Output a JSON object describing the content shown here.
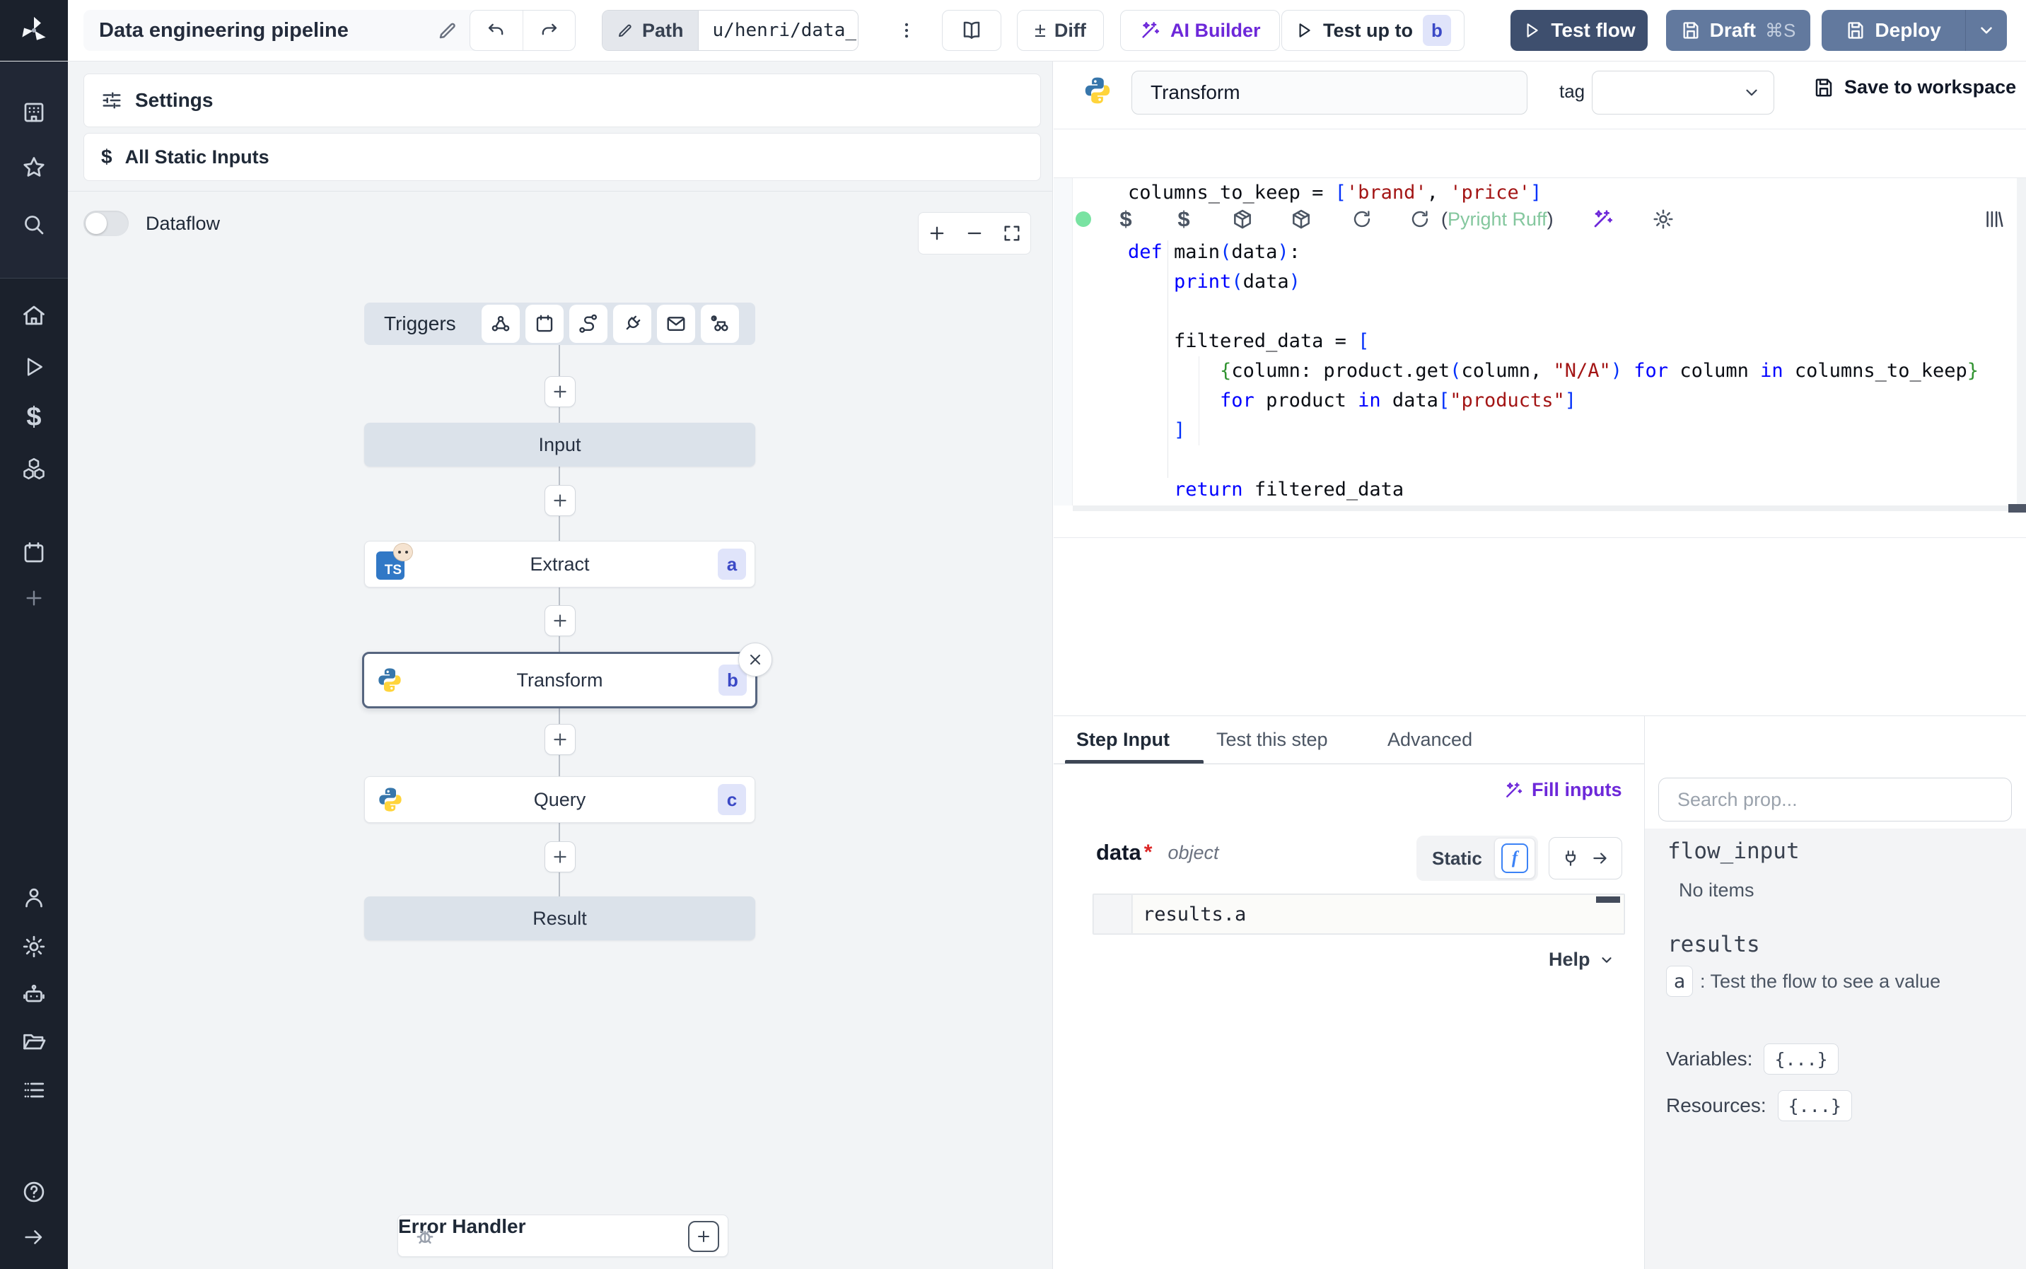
{
  "colors": {
    "sidebar_bg": "#1b212c",
    "accent_indigo": "#3b49c6",
    "badge_bg": "#e0e4fa",
    "purple": "#6d28d9",
    "test_flow_bg": "#3e4f6e",
    "deploy_bg": "#62799e",
    "node_gray_bg": "#dbe2ea",
    "selected_border": "#56657f",
    "lint_green": "#84c79e",
    "status_green": "#79e3a2",
    "code_keyword": "#0000ff",
    "code_string": "#a31515"
  },
  "topbar": {
    "title": "Data engineering pipeline",
    "path_label": "Path",
    "path_value": "u/henri/data_",
    "diff_symbol": "±",
    "diff_label": "Diff",
    "ai_builder_label": "AI Builder",
    "test_up_to_label": "Test up to",
    "test_up_to_badge": "b",
    "test_flow_label": "Test flow",
    "draft_label": "Draft",
    "draft_shortcut": "⌘S",
    "deploy_label": "Deploy"
  },
  "sidebar": {
    "icons": [
      "workspace",
      "favorites",
      "search",
      "home",
      "runs",
      "variables",
      "resources",
      "schedules",
      "add",
      "user",
      "settings",
      "workers",
      "folders",
      "logs",
      "help",
      "expand"
    ]
  },
  "flow": {
    "settings_label": "Settings",
    "static_inputs_symbol": "$",
    "static_inputs_label": "All Static Inputs",
    "dataflow_label": "Dataflow",
    "triggers_label": "Triggers",
    "trigger_icons": [
      "webhook",
      "schedule",
      "http-route",
      "websocket",
      "email",
      "scheduled-poll"
    ],
    "nodes": {
      "input_label": "Input",
      "extract_label": "Extract",
      "extract_badge": "a",
      "extract_lang": "TS",
      "transform_label": "Transform",
      "transform_badge": "b",
      "query_label": "Query",
      "query_badge": "c",
      "result_label": "Result"
    },
    "error_handler_label": "Error Handler"
  },
  "editor": {
    "step_name": "Transform",
    "tag_label": "tag",
    "save_label": "Save to workspace",
    "lint_prefix": "(",
    "lint_text": "Pyright Ruff",
    "lint_suffix": ")"
  },
  "code": {
    "lines": [
      [
        {
          "t": "columns_to_keep = ",
          "c": "pl"
        },
        {
          "t": "[",
          "c": "bk"
        },
        {
          "t": "'brand'",
          "c": "st"
        },
        {
          "t": ", ",
          "c": "pl"
        },
        {
          "t": "'price'",
          "c": "st"
        },
        {
          "t": "]",
          "c": "bk"
        }
      ],
      [],
      [
        {
          "t": "def",
          "c": "kw"
        },
        {
          "t": " main",
          "c": "pl"
        },
        {
          "t": "(",
          "c": "bk"
        },
        {
          "t": "data",
          "c": "pl"
        },
        {
          "t": ")",
          "c": "bk"
        },
        {
          "t": ":",
          "c": "pl"
        }
      ],
      [
        {
          "t": "    ",
          "c": "pl"
        },
        {
          "t": "print",
          "c": "kw"
        },
        {
          "t": "(",
          "c": "bk"
        },
        {
          "t": "data",
          "c": "pl"
        },
        {
          "t": ")",
          "c": "bk"
        }
      ],
      [],
      [
        {
          "t": "    filtered_data = ",
          "c": "pl"
        },
        {
          "t": "[",
          "c": "bk"
        }
      ],
      [
        {
          "t": "        ",
          "c": "pl"
        },
        {
          "t": "{",
          "c": "bc"
        },
        {
          "t": "column: product.get",
          "c": "pl"
        },
        {
          "t": "(",
          "c": "bk"
        },
        {
          "t": "column, ",
          "c": "pl"
        },
        {
          "t": "\"N/A\"",
          "c": "st"
        },
        {
          "t": ")",
          "c": "bk"
        },
        {
          "t": " ",
          "c": "pl"
        },
        {
          "t": "for",
          "c": "kw"
        },
        {
          "t": " column ",
          "c": "pl"
        },
        {
          "t": "in",
          "c": "kw"
        },
        {
          "t": " columns_to_keep",
          "c": "pl"
        },
        {
          "t": "}",
          "c": "bc"
        }
      ],
      [
        {
          "t": "        ",
          "c": "pl"
        },
        {
          "t": "for",
          "c": "kw"
        },
        {
          "t": " product ",
          "c": "pl"
        },
        {
          "t": "in",
          "c": "kw"
        },
        {
          "t": " data",
          "c": "pl"
        },
        {
          "t": "[",
          "c": "bk"
        },
        {
          "t": "\"products\"",
          "c": "st"
        },
        {
          "t": "]",
          "c": "bk"
        }
      ],
      [
        {
          "t": "    ",
          "c": "pl"
        },
        {
          "t": "]",
          "c": "bk"
        }
      ],
      [],
      [
        {
          "t": "    ",
          "c": "pl"
        },
        {
          "t": "return",
          "c": "kw"
        },
        {
          "t": " filtered_data",
          "c": "pl"
        }
      ]
    ]
  },
  "bottom": {
    "tabs": [
      "Step Input",
      "Test this step",
      "Advanced"
    ],
    "fill_inputs_label": "Fill inputs",
    "field_name": "data",
    "field_required": "*",
    "field_type": "object",
    "static_label": "Static",
    "static_icon": "f",
    "expr_value": "results.a",
    "help_label": "Help",
    "search_placeholder": "Search prop...",
    "picker": {
      "flow_input": "flow_input",
      "no_items": "No items",
      "results": "results",
      "result_key": "a",
      "result_hint": ":  Test the flow to see a value",
      "variables_label": "Variables:",
      "variables_value": "{...}",
      "resources_label": "Resources:",
      "resources_value": "{...}"
    }
  }
}
